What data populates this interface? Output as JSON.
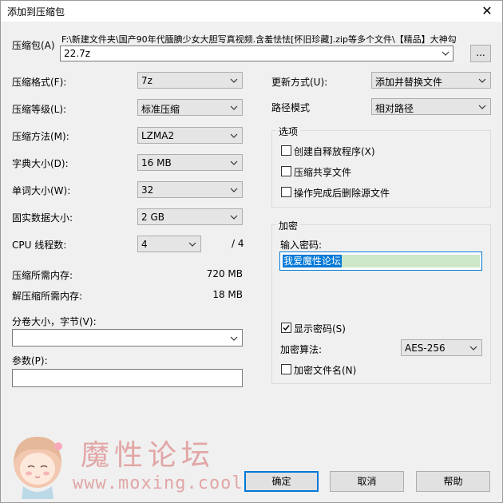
{
  "window": {
    "title": "添加到压缩包",
    "close_glyph": "✕"
  },
  "archive": {
    "label": "压缩包(A)",
    "path": "F:\\新建文件夹\\国产90年代腼腆少女大胆写真视频.含羞怯怯[怀旧珍藏].zip等多个文件\\【精品】大神勾",
    "name_value": "22.7z",
    "browse_label": "..."
  },
  "left": {
    "format_label": "压缩格式(F):",
    "format_value": "7z",
    "level_label": "压缩等级(L):",
    "level_value": "标准压缩",
    "method_label": "压缩方法(M):",
    "method_value": "LZMA2",
    "dict_label": "字典大小(D):",
    "dict_value": "16 MB",
    "word_label": "单词大小(W):",
    "word_value": "32",
    "solid_label": "固实数据大小:",
    "solid_value": "2 GB",
    "threads_label": "CPU 线程数:",
    "threads_value": "4",
    "threads_total": "/ 4",
    "mem_comp_label": "压缩所需内存:",
    "mem_comp_value": "720 MB",
    "mem_decomp_label": "解压缩所需内存:",
    "mem_decomp_value": "18 MB",
    "volume_label": "分卷大小，字节(V):",
    "volume_value": "",
    "params_label": "参数(P):",
    "params_value": ""
  },
  "right": {
    "update_label": "更新方式(U):",
    "update_value": "添加并替换文件",
    "path_label": "路径模式",
    "path_value": "相对路径",
    "options_title": "选项",
    "options": [
      {
        "label": "创建自释放程序(X)",
        "checked": false
      },
      {
        "label": "压缩共享文件",
        "checked": false
      },
      {
        "label": "操作完成后删除源文件",
        "checked": false
      }
    ],
    "encrypt_title": "加密",
    "password_label": "输入密码:",
    "password_value": "我爱魔性论坛",
    "show_password_label": "显示密码(S)",
    "show_password_checked": true,
    "algo_label": "加密算法:",
    "algo_value": "AES-256",
    "encrypt_names_label": "加密文件名(N)",
    "encrypt_names_checked": false
  },
  "buttons": {
    "ok": "确定",
    "cancel": "取消",
    "help": "帮助"
  },
  "watermark": {
    "text": "魔性论坛",
    "url": "www.moxing.cool"
  },
  "colors": {
    "accent": "#0078d7",
    "selection": "#cde8c8",
    "watermark": "#e2a6a6"
  }
}
